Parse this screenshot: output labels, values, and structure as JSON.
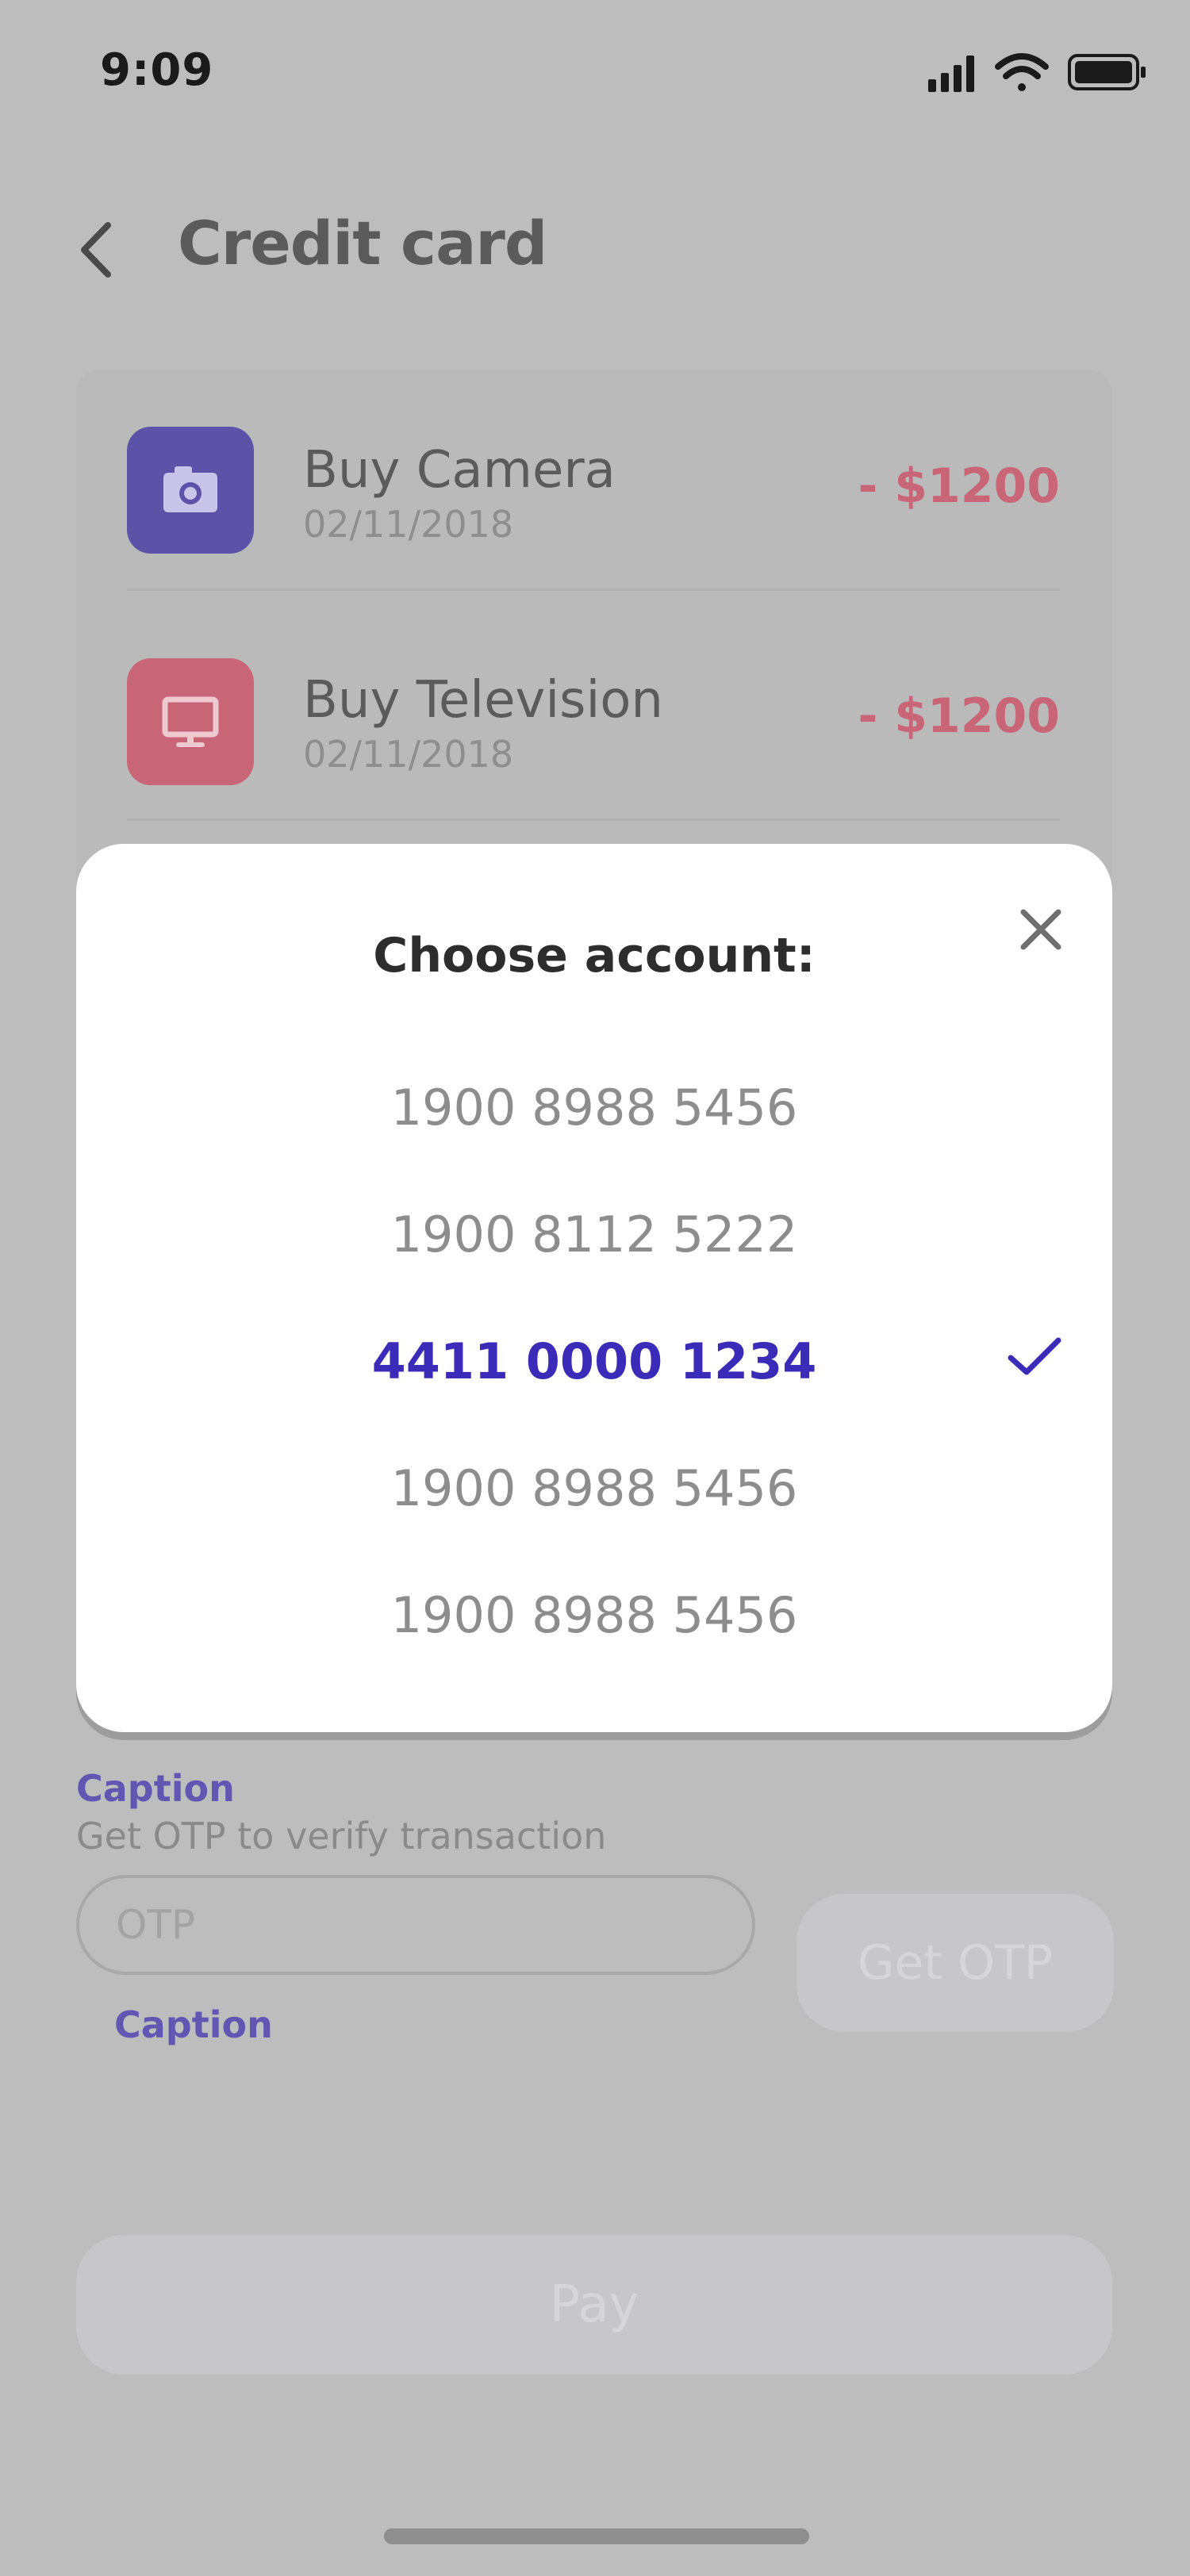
{
  "status_bar": {
    "time": "9:09"
  },
  "header": {
    "title": "Credit card"
  },
  "transactions": [
    {
      "title": "Buy Camera",
      "date": "02/11/2018",
      "amount": "- $1200",
      "icon": "camera-icon",
      "icon_color": "#5c53a8"
    },
    {
      "title": "Buy Television",
      "date": "02/11/2018",
      "amount": "- $1200",
      "icon": "tv-icon",
      "icon_color": "#c86678"
    }
  ],
  "modal": {
    "title": "Choose account:",
    "accounts": [
      "1900 8988 5456",
      "1900 8112 5222",
      "4411 0000 1234",
      "1900 8988 5456",
      "1900 8988 5456"
    ],
    "selected_index": 2,
    "selected_color": "#3a2bb8"
  },
  "form": {
    "caption_top": "Caption",
    "helper": "Get OTP to verify transaction",
    "otp_placeholder": "OTP",
    "get_otp_label": "Get OTP",
    "caption_bottom": "Caption",
    "pay_label": "Pay"
  }
}
